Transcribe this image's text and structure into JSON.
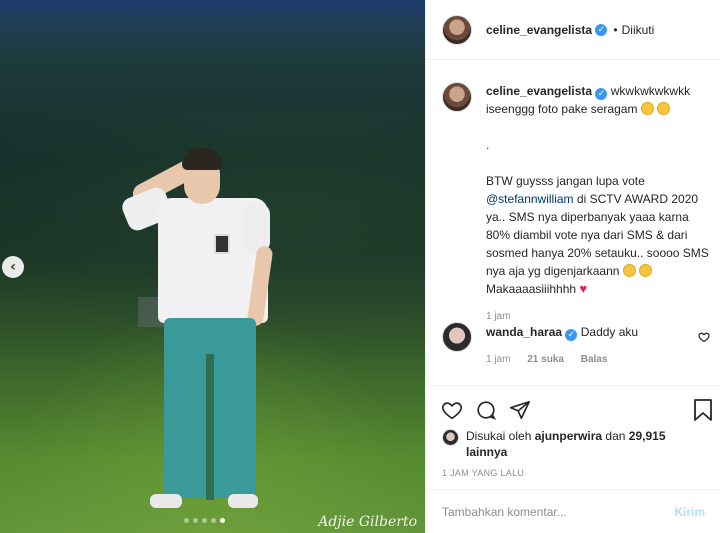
{
  "photo": {
    "watermark": "Adjie Gilberto",
    "carousel_dots": 5,
    "active_dot": 4,
    "prev_icon": "chevron-left-icon"
  },
  "header": {
    "username": "celine_evangelista",
    "separator": "•",
    "follow_status": "Diikuti"
  },
  "caption": {
    "username": "celine_evangelista",
    "line1": "wkwkwkwkwkk",
    "line2": "iseenggg foto pake seragam",
    "dot": ".",
    "p2_text_a": "BTW guysss jangan lupa vote",
    "mention": "@stefannwilliam",
    "p2_text_b": "di SCTV AWARD 2020 ya.. SMS nya diperbanyak yaaa karna 80% diambil vote nya dari SMS & dari sosmed hanya 20% setauku.. soooo SMS nya aja yg digenjarkaann",
    "p2_text_c": "Makaaaasiiihhhh",
    "time": "1 jam"
  },
  "comment": {
    "username": "wanda_haraa",
    "text": "Daddy aku",
    "time": "1 jam",
    "likes": "21 suka",
    "reply": "Balas"
  },
  "likes": {
    "prefix": "Disukai oleh",
    "user": "ajunperwira",
    "conj": "dan",
    "count": "29,915 lainnya"
  },
  "timestamp": "1 JAM YANG LALU",
  "add_comment": {
    "placeholder": "Tambahkan komentar...",
    "send_label": "Kirim"
  },
  "colors": {
    "verified": "#3897f0",
    "mention": "#00376b",
    "send_disabled": "#b2dffc",
    "heart": "#e0245e"
  }
}
